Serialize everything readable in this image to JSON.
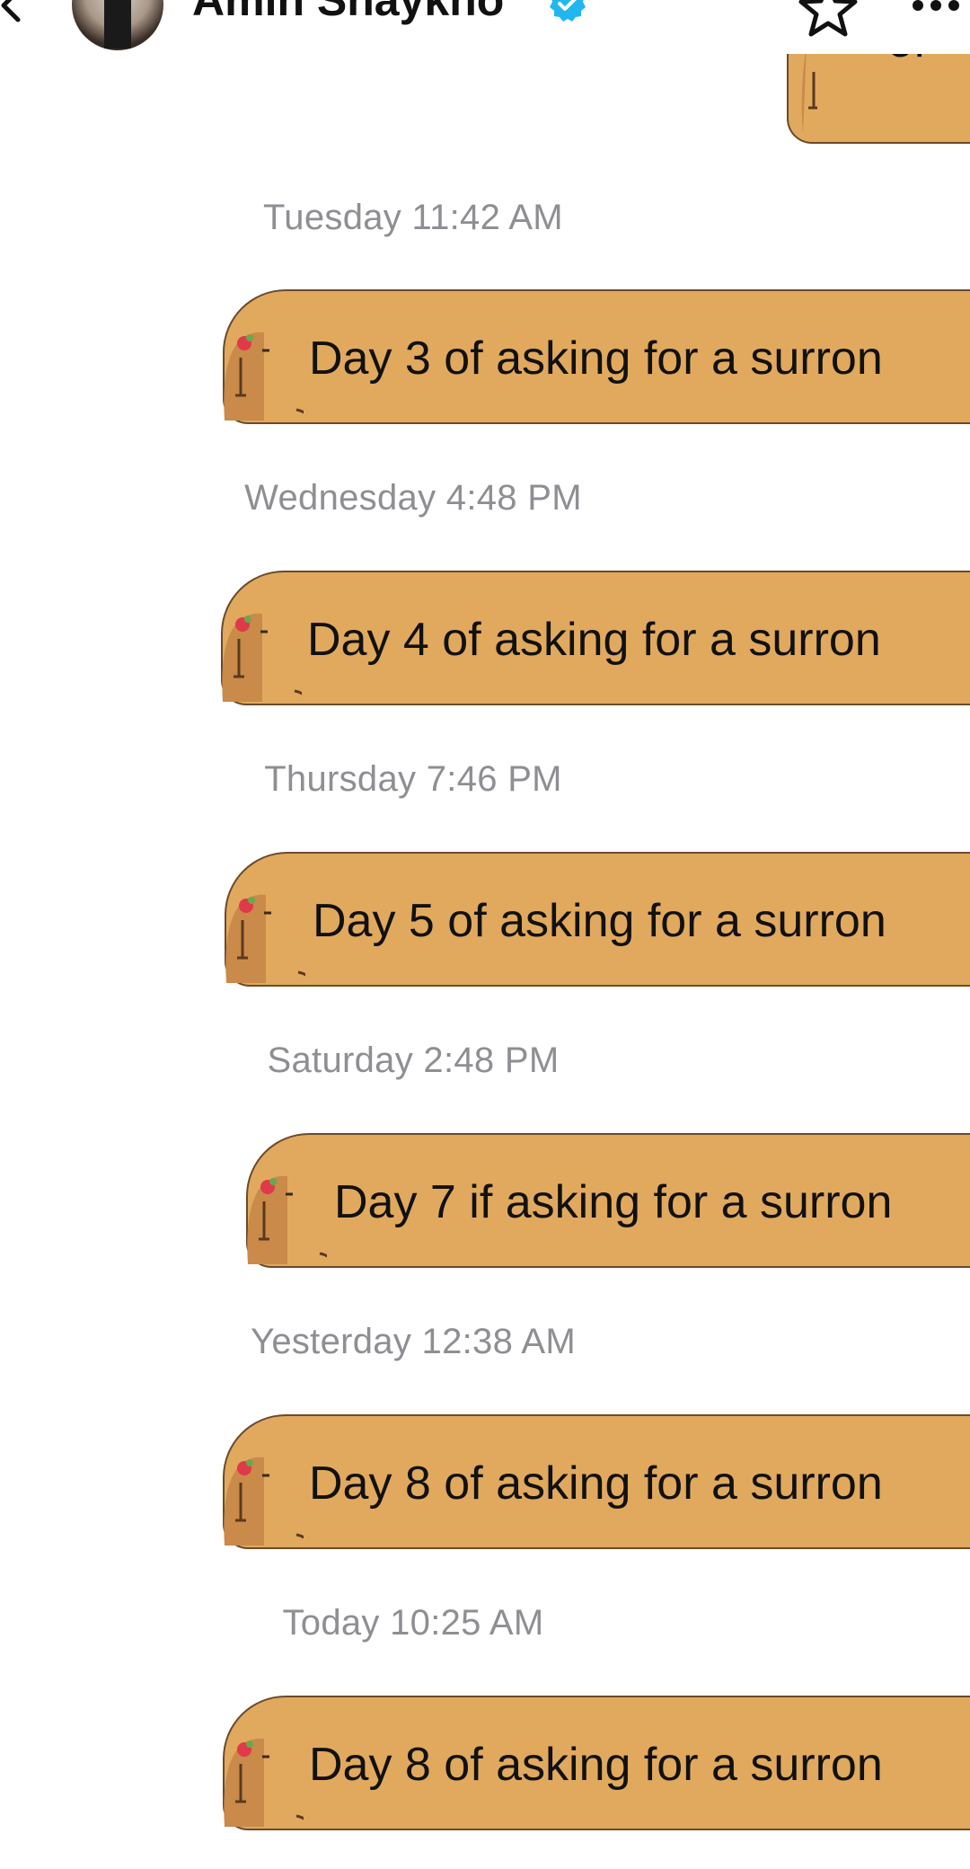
{
  "header": {
    "contact_name": "Amin Shaykho",
    "icons": {
      "back": "chevron-left-icon",
      "verified": "verified-badge-icon",
      "favorite": "star-icon",
      "more": "more-dots-icon"
    }
  },
  "colors": {
    "bubble": "#e1a95e",
    "bubble_outline": "#6b4a2a",
    "timestamp": "#8e8e93",
    "verified": "#20b7ef"
  },
  "conversation": {
    "top_bubble_partial": "of",
    "messages": [
      {
        "timestamp": "Tuesday 11:42 AM",
        "text": "Day 3 of asking for a surron"
      },
      {
        "timestamp": "Wednesday 4:48 PM",
        "text": "Day 4 of asking for a surron"
      },
      {
        "timestamp": "Thursday 7:46 PM",
        "text": "Day 5 of asking for a surron"
      },
      {
        "timestamp": "Saturday 2:48 PM",
        "text": "Day 7 if asking for a surron"
      },
      {
        "timestamp": "Yesterday 12:38 AM",
        "text": "Day 8 of asking for a surron"
      },
      {
        "timestamp": "Today 10:25 AM",
        "text": "Day 8 of asking for a surron"
      }
    ]
  }
}
